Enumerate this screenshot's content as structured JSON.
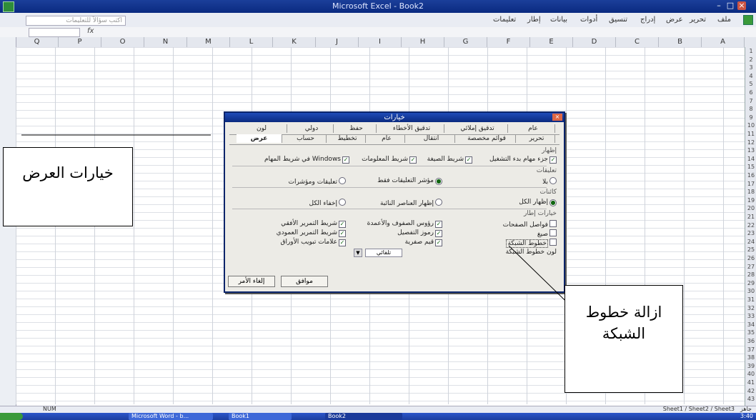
{
  "window": {
    "title": "Microsoft Excel - Book2"
  },
  "menu": {
    "items": [
      "ملف",
      "تحرير",
      "عرض",
      "إدراج",
      "تنسيق",
      "أدوات",
      "بيانات",
      "إطار",
      "تعليمات"
    ],
    "help_placeholder": "اكتب سؤالاً للتعليمات"
  },
  "formula": {
    "fx_label": "fx"
  },
  "columns": [
    "Q",
    "P",
    "O",
    "N",
    "M",
    "L",
    "K",
    "J",
    "I",
    "H",
    "G",
    "F",
    "E",
    "D",
    "C",
    "B",
    "A"
  ],
  "rows": [
    "1",
    "2",
    "3",
    "4",
    "5",
    "6",
    "7",
    "8",
    "9",
    "10",
    "11",
    "12",
    "13",
    "14",
    "15",
    "16",
    "17",
    "18",
    "19",
    "20",
    "21",
    "22",
    "23",
    "24",
    "25",
    "26",
    "27",
    "28",
    "29",
    "30",
    "31",
    "32",
    "33",
    "34",
    "35",
    "36",
    "37",
    "38",
    "39",
    "40",
    "41",
    "42",
    "43"
  ],
  "dialog": {
    "title": "خيارات",
    "tabs_row1": [
      "عام",
      "تدقيق إملائي",
      "تدقيق الأخطاء",
      "حفظ",
      "دولي",
      "لون"
    ],
    "tabs_row2": [
      "تحرير",
      "قوائم مخصصة",
      "انتقال",
      "عام",
      "تخطيط",
      "حساب",
      "عرض"
    ],
    "sections": {
      "show": "إظهار",
      "comments": "تعليقات",
      "objects": "كائنات",
      "window_options": "خيارات إطار"
    },
    "show_options": [
      {
        "label": "جزء مهام بدء التشغيل",
        "checked": true
      },
      {
        "label": "شريط الصيغة",
        "checked": true
      },
      {
        "label": "شريط المعلومات",
        "checked": true
      },
      {
        "label": "Windows في شريط المهام",
        "checked": true
      }
    ],
    "comment_options": [
      {
        "label": "بلا",
        "checked": false
      },
      {
        "label": "مؤشر التعليقات فقط",
        "checked": true
      },
      {
        "label": "تعليقات ومؤشرات",
        "checked": false
      }
    ],
    "object_options": [
      {
        "label": "إظهار الكل",
        "checked": true
      },
      {
        "label": "إظهار العناصر النائبة",
        "checked": false
      },
      {
        "label": "إخفاء الكل",
        "checked": false
      }
    ],
    "window_col1": [
      {
        "label": "فواصل الصفحات",
        "checked": false
      },
      {
        "label": "صيغ",
        "checked": false
      },
      {
        "label": "خطوط الشبكة",
        "checked": false
      }
    ],
    "window_col2": [
      {
        "label": "رؤوس الصفوف والأعمدة",
        "checked": true
      },
      {
        "label": "رموز التفصيل",
        "checked": true
      },
      {
        "label": "قيم صفرية",
        "checked": true
      }
    ],
    "window_col3": [
      {
        "label": "شريط التمرير الأفقي",
        "checked": true
      },
      {
        "label": "شريط التمرير العمودي",
        "checked": true
      },
      {
        "label": "علامات تبويب الأوراق",
        "checked": true
      }
    ],
    "gridline_color_label": "لون خطوط الشبكة",
    "gridline_color_value": "تلقائي",
    "ok": "موافق",
    "cancel": "إلغاء الأمر"
  },
  "sheet_tabs": "Sheet1 / Sheet2 / Sheet3",
  "status": {
    "left": "جاهز",
    "right": "NUM"
  },
  "taskbar": {
    "items": [
      "Microsoft Word - b...",
      "Book1",
      "Book2"
    ],
    "clock": "3:40"
  },
  "annotations": {
    "display_options": "خيارات العرض",
    "remove_gridlines": "ازالة خطوط الشبكة"
  }
}
